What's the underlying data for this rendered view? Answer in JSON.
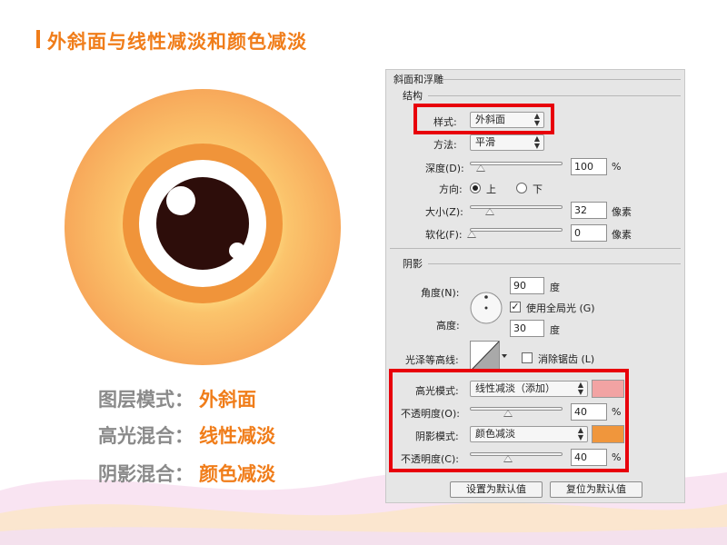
{
  "title": "外斜面与线性减淡和颜色减淡",
  "captions": [
    {
      "label": "图层模式：",
      "value": "外斜面"
    },
    {
      "label": "高光混合：",
      "value": "线性减淡"
    },
    {
      "label": "阴影混合：",
      "value": "颜色减淡"
    }
  ],
  "panel": {
    "header": "斜面和浮雕",
    "structure": {
      "heading": "结构",
      "style_label": "样式:",
      "style_value": "外斜面",
      "technique_label": "方法:",
      "technique_value": "平滑",
      "depth_label": "深度(D):",
      "depth_value": "100",
      "depth_unit": "%",
      "direction_label": "方向:",
      "direction_up": "上",
      "direction_down": "下",
      "size_label": "大小(Z):",
      "size_value": "32",
      "size_unit": "像素",
      "soften_label": "软化(F):",
      "soften_value": "0",
      "soften_unit": "像素"
    },
    "shading": {
      "heading": "阴影",
      "angle_label": "角度(N):",
      "angle_value": "90",
      "angle_unit": "度",
      "global_light_label": "使用全局光 (G)",
      "global_light_checked": "✓",
      "altitude_label": "高度:",
      "altitude_value": "30",
      "altitude_unit": "度",
      "gloss_label": "光泽等高线:",
      "antialias_label": "消除锯齿 (L)",
      "highlight_mode_label": "高光模式:",
      "highlight_mode_value": "线性减淡（添加）",
      "highlight_color": "#f2a3a3",
      "highlight_opacity_label": "不透明度(O):",
      "highlight_opacity_value": "40",
      "highlight_opacity_unit": "%",
      "shadow_mode_label": "阴影模式:",
      "shadow_mode_value": "颜色减淡",
      "shadow_color": "#f0963c",
      "shadow_opacity_label": "不透明度(C):",
      "shadow_opacity_value": "40",
      "shadow_opacity_unit": "%"
    },
    "buttons": {
      "make_default": "设置为默认值",
      "reset_default": "复位为默认值"
    }
  },
  "colors": {
    "accent": "#f07d1a",
    "highlight_box": "#e8000b"
  }
}
